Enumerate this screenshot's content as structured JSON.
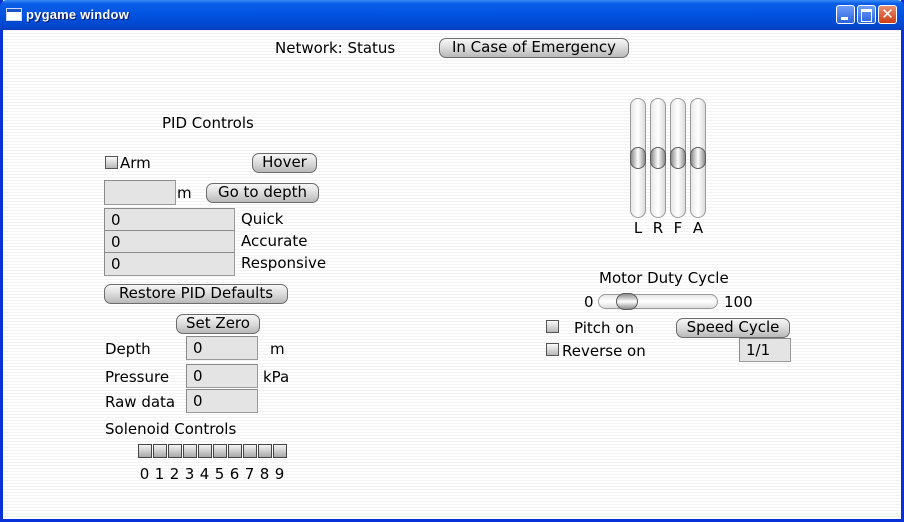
{
  "window": {
    "title": "pygame window"
  },
  "header": {
    "network_status": "Network: Status",
    "emergency_label": "In Case of Emergency"
  },
  "pid": {
    "title": "PID Controls",
    "arm_label": "Arm",
    "arm_checked": false,
    "hover_label": "Hover",
    "depth_input_value": "",
    "depth_unit": "m",
    "goto_label": "Go to depth",
    "rows": [
      {
        "value": "0",
        "label": "Quick"
      },
      {
        "value": "0",
        "label": "Accurate"
      },
      {
        "value": "0",
        "label": "Responsive"
      }
    ],
    "restore_label": "Restore PID Defaults"
  },
  "sensors": {
    "set_zero_label": "Set Zero",
    "depth_label": "Depth",
    "depth_value": "0",
    "depth_unit": "m",
    "pressure_label": "Pressure",
    "pressure_value": "0",
    "pressure_unit": "kPa",
    "raw_label": "Raw data",
    "raw_value": "0"
  },
  "solenoid": {
    "title": "Solenoid Controls",
    "numbers": [
      "0",
      "1",
      "2",
      "3",
      "4",
      "5",
      "6",
      "7",
      "8",
      "9"
    ]
  },
  "thrusters": {
    "labels": [
      "L",
      "R",
      "F",
      "A"
    ],
    "levels": [
      0.5,
      0.5,
      0.5,
      0.5
    ]
  },
  "motor": {
    "title": "Motor Duty Cycle",
    "min_label": "0",
    "max_label": "100",
    "duty_value": 17,
    "pitch_label": "Pitch on",
    "pitch_checked": false,
    "speed_cycle_label": "Speed Cycle",
    "reverse_label": "Reverse on",
    "reverse_checked": false,
    "speed_value": "1/1"
  },
  "icons": {
    "window_icon": "window-icon",
    "minimize": "minimize-icon",
    "maximize": "maximize-icon",
    "close": "close-icon"
  }
}
